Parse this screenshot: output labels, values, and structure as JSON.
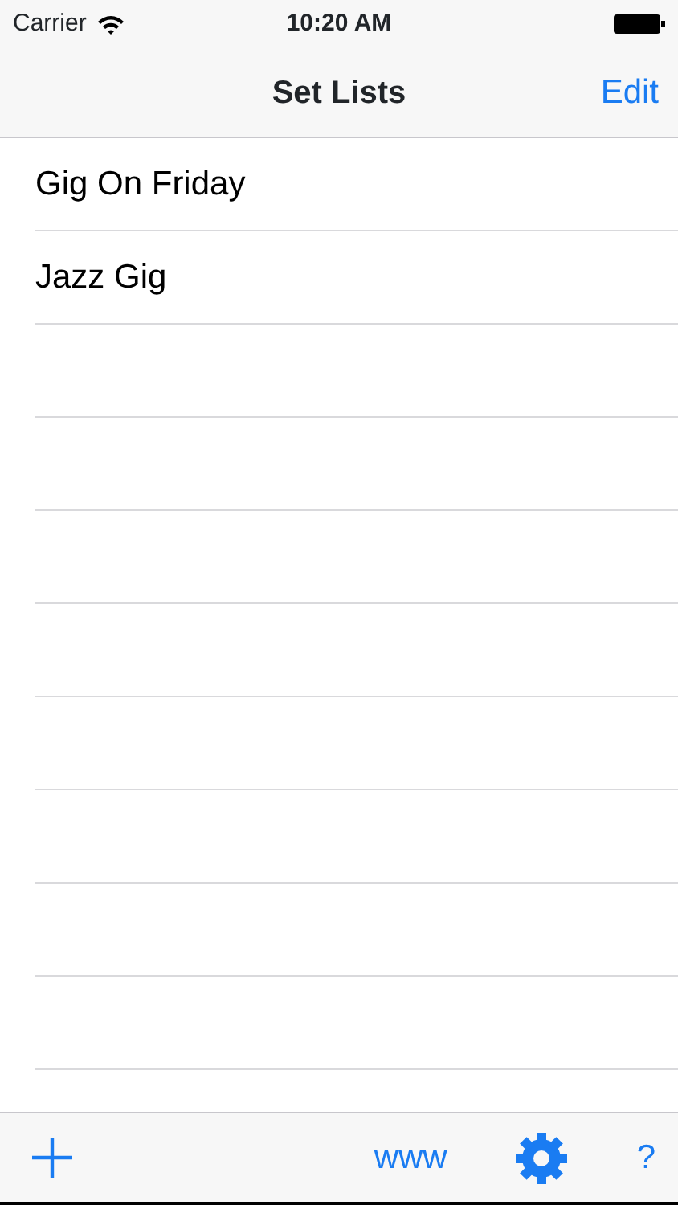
{
  "status_bar": {
    "carrier": "Carrier",
    "time": "10:20 AM"
  },
  "nav_bar": {
    "title": "Set Lists",
    "edit_button": "Edit"
  },
  "set_lists": [
    {
      "name": "Gig On Friday"
    },
    {
      "name": "Jazz Gig"
    }
  ],
  "toolbar": {
    "www_button": "www",
    "help_button": "?"
  }
}
